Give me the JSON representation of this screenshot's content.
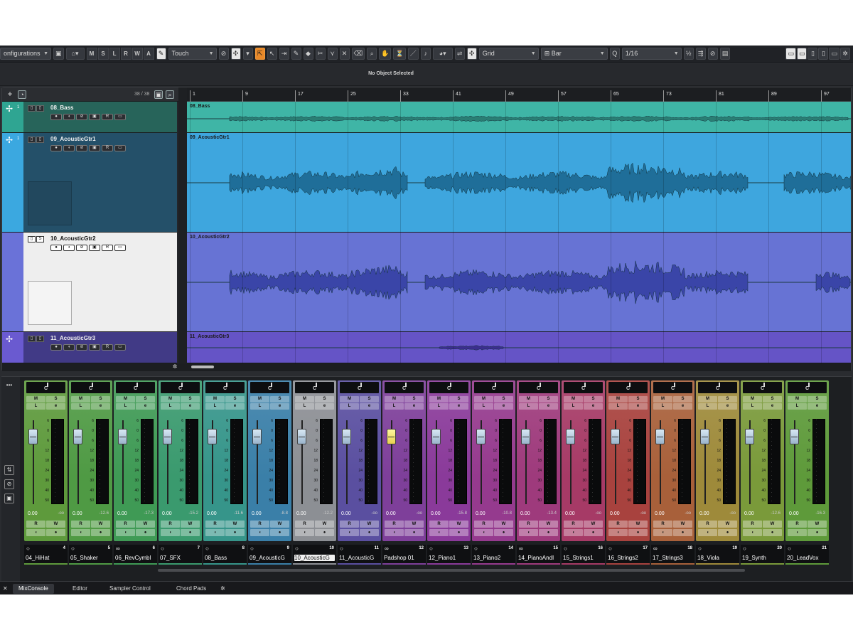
{
  "toolbar": {
    "configurations": "onfigurations",
    "automation_letters": [
      "M",
      "S",
      "L",
      "R",
      "W",
      "A"
    ],
    "automation_mode": "Touch",
    "snap_type": "Grid",
    "grid_type": "Bar",
    "quantize_label": "Q",
    "quantize_value": "1/16"
  },
  "info_line": "No Object Selected",
  "tracklist": {
    "count": "38 / 38"
  },
  "tracks": [
    {
      "name": "08_Bass",
      "num": "1"
    },
    {
      "name": "09_AcousticGtr1",
      "num": "1"
    },
    {
      "name": "10_AcousticGtr2",
      "num": ""
    },
    {
      "name": "11_AcousticGtr3",
      "num": ""
    }
  ],
  "ruler": [
    "1",
    "9",
    "17",
    "25",
    "33",
    "41",
    "49",
    "57",
    "65",
    "73",
    "81",
    "89",
    "97"
  ],
  "events": [
    {
      "name": "08_Bass"
    },
    {
      "name": "09_AcousticGtr1"
    },
    {
      "name": "10_AcousticGtr2"
    },
    {
      "name": "11_AcousticGtr3"
    }
  ],
  "mixer": {
    "pan_label": "C",
    "btn_m": "M",
    "btn_s": "S",
    "btn_l": "L",
    "btn_e": "e",
    "btn_r": "R",
    "btn_w": "W",
    "scale": [
      "6",
      "0",
      "6",
      "12",
      "18",
      "24",
      "30",
      "40",
      "50"
    ],
    "channels": [
      {
        "name": "04_HiHat",
        "num": "4",
        "vol": "0.00",
        "peak": "-oo",
        "color": "#5e9a3c"
      },
      {
        "name": "05_Shaker",
        "num": "5",
        "vol": "0.00",
        "peak": "-12.6",
        "color": "#4f9a44"
      },
      {
        "name": "06_RevCymbl",
        "num": "6",
        "vol": "0.00",
        "peak": "-17.3",
        "color": "#3f9a55"
      },
      {
        "name": "07_SFX",
        "num": "7",
        "vol": "0.00",
        "peak": "-15.2",
        "color": "#3a9a6e"
      },
      {
        "name": "08_Bass",
        "num": "8",
        "vol": "0.00",
        "peak": "-11.6",
        "color": "#36958a"
      },
      {
        "name": "09_AcousticG",
        "num": "9",
        "vol": "0.00",
        "peak": "-8.8",
        "color": "#3a7fa8"
      },
      {
        "name": "10_AcousticG",
        "num": "10",
        "vol": "0.00",
        "peak": "-12.2",
        "color": "#8c8f94"
      },
      {
        "name": "11_AcousticG",
        "num": "11",
        "vol": "0.00",
        "peak": "-oo",
        "color": "#5a4fa0"
      },
      {
        "name": "Padshop 01",
        "num": "12",
        "vol": "0.00",
        "peak": "-oo",
        "color": "#7e3f9a"
      },
      {
        "name": "12_Piano1",
        "num": "13",
        "vol": "0.00",
        "peak": "-15.8",
        "color": "#8a3a9a"
      },
      {
        "name": "13_Piano2",
        "num": "14",
        "vol": "0.00",
        "peak": "-10.8",
        "color": "#953a8e"
      },
      {
        "name": "14_PianoAndI",
        "num": "15",
        "vol": "0.00",
        "peak": "-13.4",
        "color": "#9e3a7c"
      },
      {
        "name": "15_Strings1",
        "num": "16",
        "vol": "0.00",
        "peak": "-oo",
        "color": "#a63a66"
      },
      {
        "name": "16_Strings2",
        "num": "17",
        "vol": "0.00",
        "peak": "-oo",
        "color": "#a8423e"
      },
      {
        "name": "17_Strings3",
        "num": "18",
        "vol": "0.00",
        "peak": "-oo",
        "color": "#a8603a"
      },
      {
        "name": "18_Viola",
        "num": "19",
        "vol": "0.00",
        "peak": "-oo",
        "color": "#9e8a3a"
      },
      {
        "name": "19_Synth",
        "num": "20",
        "vol": "0.00",
        "peak": "-12.6",
        "color": "#7a9a3a"
      },
      {
        "name": "20_LeadVox",
        "num": "21",
        "vol": "0.00",
        "peak": "-16.3",
        "color": "#5e9a3a"
      }
    ]
  },
  "tabs": [
    "MixConsole",
    "Editor",
    "Sampler Control",
    "Chord Pads"
  ]
}
